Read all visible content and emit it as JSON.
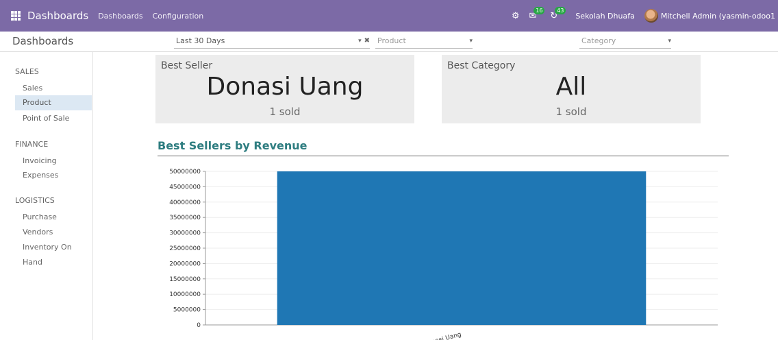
{
  "navbar": {
    "brand": "Dashboards",
    "menu": [
      "Dashboards",
      "Configuration"
    ],
    "chat_badge": "16",
    "activity_badge": "43",
    "company": "Sekolah Dhuafa",
    "user": "Mitchell Admin (yasmin-odoo1"
  },
  "control": {
    "breadcrumb": "Dashboards",
    "date_filter": "Last 30 Days",
    "product_placeholder": "Product",
    "category_placeholder": "Category"
  },
  "sidebar": {
    "sections": [
      {
        "title": "SALES",
        "items": [
          "Sales",
          "Product",
          "Point of Sale"
        ]
      },
      {
        "title": "FINANCE",
        "items": [
          "Invoicing",
          "Expenses"
        ]
      },
      {
        "title": "LOGISTICS",
        "items": [
          "Purchase",
          "Vendors",
          "Inventory On Hand"
        ]
      }
    ],
    "active_item": "Product"
  },
  "cards": {
    "best_seller": {
      "label": "Best Seller",
      "value": "Donasi Uang",
      "sub": "1 sold"
    },
    "best_category": {
      "label": "Best Category",
      "value": "All",
      "sub": "1 sold"
    }
  },
  "section": {
    "title": "Best Sellers by Revenue"
  },
  "colors": {
    "navbar": "#7c6aa6",
    "bar": "#1f77b4",
    "title": "#2e7d80"
  },
  "chart_data": {
    "type": "bar",
    "categories": [
      "Donasi Uang"
    ],
    "values": [
      50000000
    ],
    "title": "",
    "xlabel": "",
    "ylabel": "",
    "ylim": [
      0,
      50000000
    ],
    "yticks": [
      0,
      5000000,
      10000000,
      15000000,
      20000000,
      25000000,
      30000000,
      35000000,
      40000000,
      45000000,
      50000000
    ],
    "grid": true
  }
}
